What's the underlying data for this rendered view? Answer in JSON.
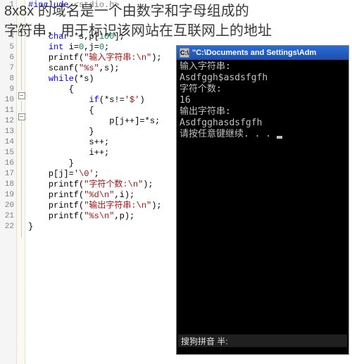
{
  "overlay": {
    "line1": "8x8x 的域名是一个由数字和字母组成的",
    "line2": "字符串，用于标识该网站在互联网上的地址"
  },
  "code_lines": [
    {
      "n": "1",
      "joint": "",
      "html": "<span class='kw'>#include</span> <span class='cmt'>&lt;stdio.h&gt;</span>"
    },
    {
      "n": "",
      "joint": "",
      "html": ""
    },
    {
      "n": "",
      "joint": "box",
      "html": ""
    },
    {
      "n": "4",
      "joint": "line",
      "html": "    <span class='kw'>char</span> *s,p[<span class='num'>100</span>];"
    },
    {
      "n": "5",
      "joint": "line",
      "html": "    <span class='kw'>int</span> i=<span class='num'>0</span>,j=<span class='num'>0</span>;"
    },
    {
      "n": "6",
      "joint": "line",
      "html": "    printf(<span class='str'>\"输入字符串:\\n\"</span>);"
    },
    {
      "n": "7",
      "joint": "line",
      "html": "    scanf(<span class='str'>\"%s\"</span>,s);"
    },
    {
      "n": "8",
      "joint": "line",
      "html": "    <span class='kw'>while</span>(*s)"
    },
    {
      "n": "9",
      "joint": "box",
      "html": "        {"
    },
    {
      "n": "10",
      "joint": "line",
      "html": "            <span class='kw'>if</span>(*s!=<span class='str'>'$'</span>)"
    },
    {
      "n": "11",
      "joint": "box",
      "html": "            {"
    },
    {
      "n": "12",
      "joint": "line",
      "html": "                p[j++]=*s;"
    },
    {
      "n": "13",
      "joint": "line",
      "html": "            }"
    },
    {
      "n": "14",
      "joint": "line",
      "html": "            s++;"
    },
    {
      "n": "15",
      "joint": "line",
      "html": "            i++;"
    },
    {
      "n": "16",
      "joint": "line",
      "html": "        }"
    },
    {
      "n": "17",
      "joint": "line",
      "html": "    p[j]=<span class='str'>'\\0'</span>;"
    },
    {
      "n": "18",
      "joint": "line",
      "html": "    printf(<span class='str'>\"字符个数:\\n\"</span>);"
    },
    {
      "n": "19",
      "joint": "line",
      "html": "    printf(<span class='str'>\"%d\\n\"</span>,i);"
    },
    {
      "n": "20",
      "joint": "line",
      "html": "    printf(<span class='str'>\"输出字符串:\\n\"</span>);"
    },
    {
      "n": "21",
      "joint": "line",
      "html": "    printf(<span class='str'>\"%s\\n\"</span>,p);"
    },
    {
      "n": "22",
      "joint": "line",
      "html": "}"
    }
  ],
  "console": {
    "titlebar_icon": "C:\\",
    "titlebar_text": "\"C:\\Documents and Settings\\Adm",
    "output": [
      "输入字符串:",
      "Asdfggh$asdsfgfh",
      "字符个数:",
      "16",
      "输出字符串:",
      "Asdfgghasdsfgfh",
      "请按任意键继续. . . "
    ],
    "ime_text": "搜狗拼音  半:"
  }
}
